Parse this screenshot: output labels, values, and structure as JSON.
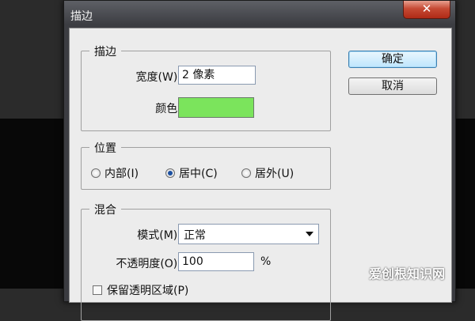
{
  "window": {
    "title": "描边",
    "close_label": "✕"
  },
  "stroke": {
    "group_label": "描边",
    "width_label": "宽度(W):",
    "width_value": "2 像素",
    "color_label": "颜色:",
    "color_hex": "#7be45c"
  },
  "position": {
    "group_label": "位置",
    "options": [
      {
        "label": "内部(I)",
        "selected": false
      },
      {
        "label": "居中(C)",
        "selected": true
      },
      {
        "label": "居外(U)",
        "selected": false
      }
    ]
  },
  "blend": {
    "group_label": "混合",
    "mode_label": "模式(M):",
    "mode_value": "正常",
    "opacity_label": "不透明度(O):",
    "opacity_value": "100",
    "opacity_unit": "%",
    "preserve_label": "保留透明区域(P)"
  },
  "buttons": {
    "ok": "确定",
    "cancel": "取消"
  },
  "watermark": "爱创根知识网"
}
